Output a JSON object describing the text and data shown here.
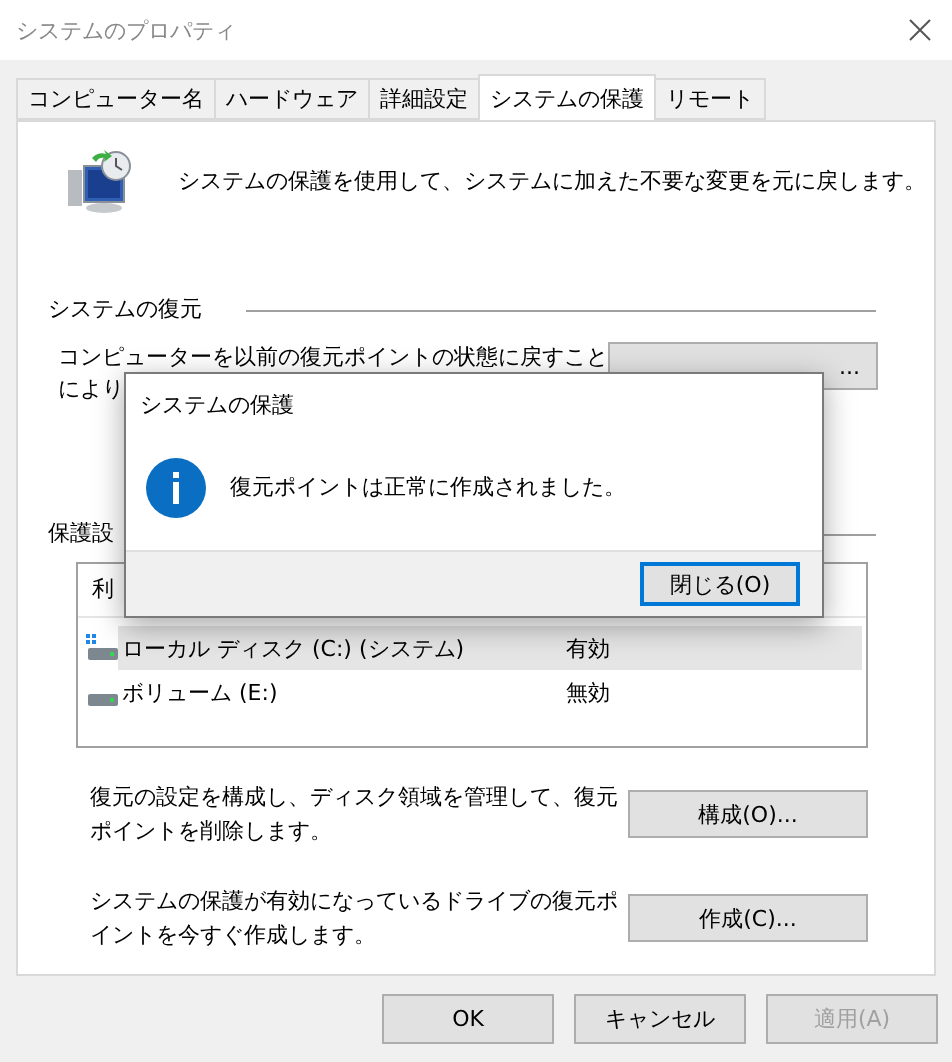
{
  "window": {
    "title": "システムのプロパティ"
  },
  "tabs": [
    {
      "label": "コンピューター名",
      "selected": false
    },
    {
      "label": "ハードウェア",
      "selected": false
    },
    {
      "label": "詳細設定",
      "selected": false
    },
    {
      "label": "システムの保護",
      "selected": true
    },
    {
      "label": "リモート",
      "selected": false
    }
  ],
  "intro": "システムの保護を使用して、システムに加えた不要な変更を元に戻します。",
  "restore": {
    "title": "システムの復元",
    "lines": [
      "コンピューターを以前の復元ポイントの状態に戻すこと",
      "により"
    ],
    "button": "..."
  },
  "protection": {
    "title": "保護設",
    "columns": [
      "利"
    ],
    "rows": [
      {
        "drive": "ローカル ディスク (C:) (システム)",
        "status": "有効",
        "kind": "system",
        "selected": true
      },
      {
        "drive": "ボリューム (E:)",
        "status": "無効",
        "kind": "volume",
        "selected": false
      }
    ]
  },
  "actions": [
    {
      "text": "復元の設定を構成し、ディスク領域を管理して、復元ポイントを削除します。",
      "button": "構成(O)..."
    },
    {
      "text": "システムの保護が有効になっているドライブの復元ポイントを今すぐ作成します。",
      "button": "作成(C)..."
    }
  ],
  "buttons": [
    {
      "label": "OK",
      "disabled": false
    },
    {
      "label": "キャンセル",
      "disabled": false
    },
    {
      "label": "適用(A)",
      "disabled": true
    }
  ],
  "dialog": {
    "title": "システムの保護",
    "message": "復元ポイントは正常に作成されました。",
    "button": "閉じる(O)",
    "focused": true
  }
}
